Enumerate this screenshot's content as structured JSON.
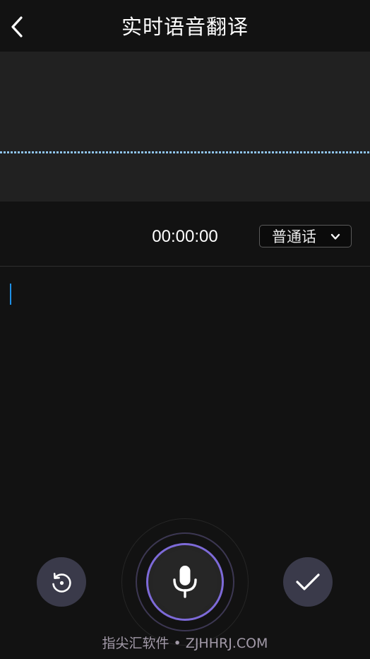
{
  "header": {
    "title": "实时语音翻译",
    "back_icon": "chevron-left-icon"
  },
  "recorder": {
    "timer": "00:00:00",
    "language": "普通话",
    "language_icon": "chevron-down-icon",
    "transcript": ""
  },
  "controls": {
    "reset_icon": "rotate-ccw-icon",
    "mic_icon": "microphone-icon",
    "confirm_icon": "check-icon"
  },
  "watermark": "指尖汇软件 • ZJHHRJ.COM",
  "colors": {
    "background": "#121212",
    "wave_panel": "#212121",
    "waveform": "#8fc5f0",
    "caret": "#1e90e6",
    "mic_ring": "#7d6ad8",
    "round_button": "#3a3a4a"
  }
}
